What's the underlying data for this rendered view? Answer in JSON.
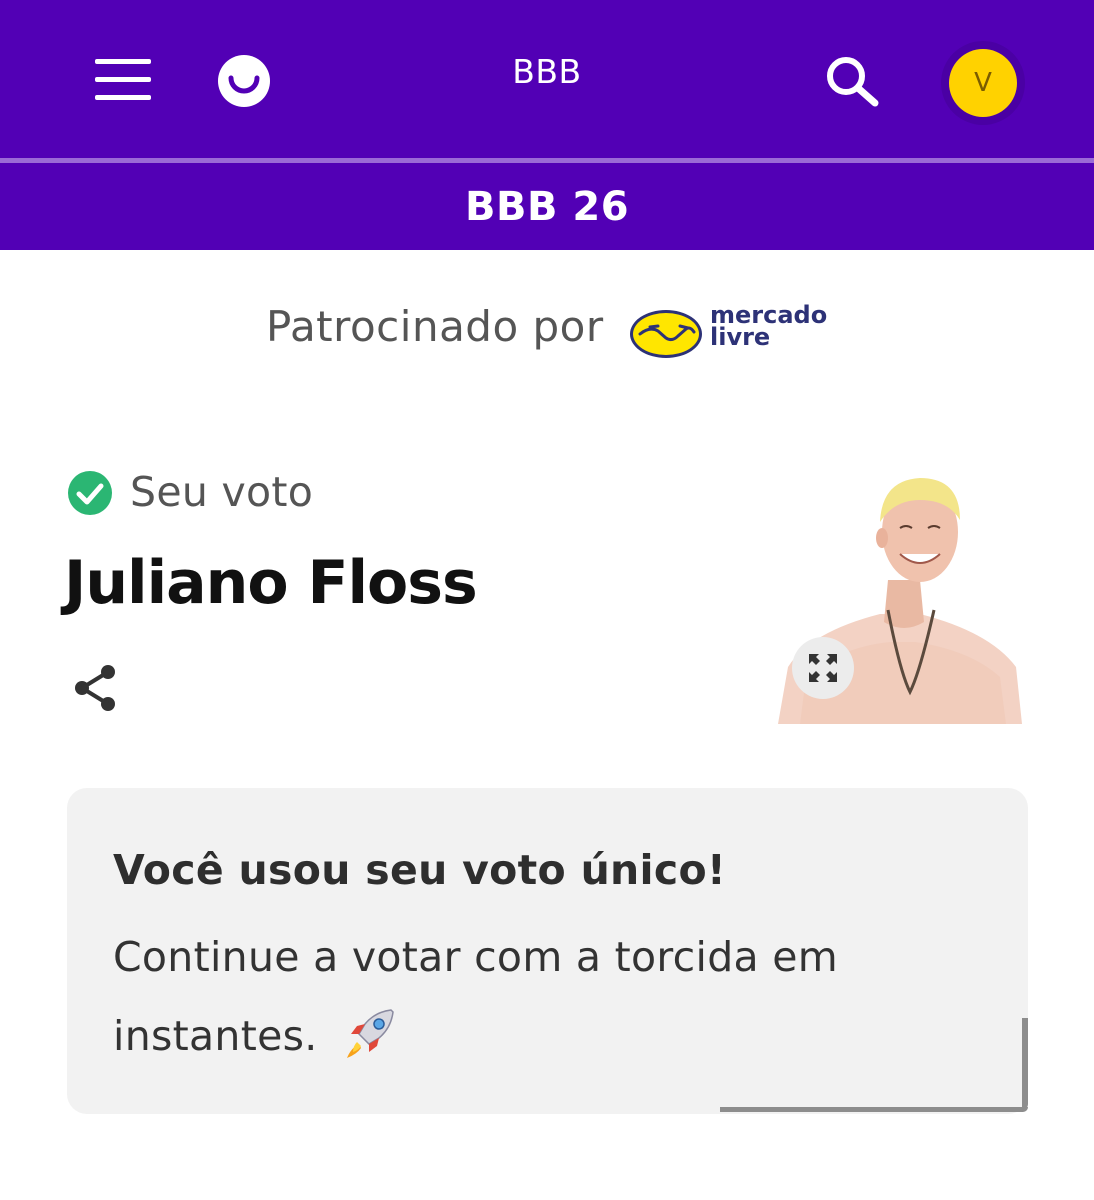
{
  "header": {
    "title": "BBB",
    "section_title": "BBB 26",
    "avatar_initial": "V",
    "brand_color": "#5200b5",
    "avatar_color": "#ffd200",
    "icons": [
      "menu-icon",
      "globo-logo-icon",
      "search-icon"
    ]
  },
  "sponsor": {
    "label": "Patrocinado por",
    "brand_line1": "mercado",
    "brand_line2": "livre",
    "brand_icon": "handshake-logo"
  },
  "vote": {
    "status_label": "Seu voto",
    "status_color": "#2bb673",
    "candidate_name": "Juliano Floss",
    "icons": [
      "check-circle-icon",
      "share-icon",
      "expand-icon"
    ]
  },
  "message": {
    "title": "Você usou seu voto único!",
    "body": "Continue a votar com a torcida em instantes.",
    "emoji": "rocket-icon"
  }
}
